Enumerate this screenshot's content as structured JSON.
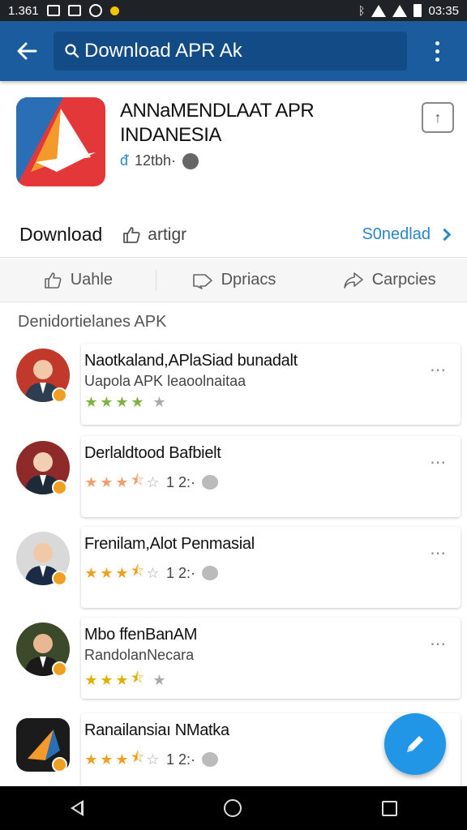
{
  "status_bar": {
    "time_left": "1.361",
    "time_right": "03:35",
    "icons": [
      "image-icon",
      "gallery-icon",
      "whatsapp-icon",
      "notification-dot-icon",
      "bluetooth-icon",
      "wifi-icon",
      "signal-icon",
      "battery-icon"
    ]
  },
  "app_bar": {
    "search_text": "Download APR Ak",
    "icons": [
      "back-arrow-icon",
      "search-icon",
      "more-vert-icon"
    ],
    "color": "#1a5c9e"
  },
  "app": {
    "title": "ANNaMENDLAAT APR INDANESIA",
    "meta": "12tbh·",
    "icon_colors": [
      "#e3373a",
      "#2a6fb5",
      "#f39a2a",
      "#ffffff"
    ]
  },
  "download_row": {
    "label": "Download",
    "action_label": "artigr",
    "link_label": "S0nedlad"
  },
  "tabs": [
    {
      "label": "Uahle",
      "icon": "thumbs-up-icon"
    },
    {
      "label": "Dpriacs",
      "icon": "tag-icon"
    },
    {
      "label": "Carpcies",
      "icon": "share-icon"
    }
  ],
  "section_title": "Denidortielanes APK",
  "list": [
    {
      "title": "Naotkaland,APlaSiad bunadalt",
      "subtitle": "Uapola APK leaoolnaitaa",
      "rating": 4,
      "star_color": "#7cb342",
      "rating_meta": ""
    },
    {
      "title": "Derlaldtood Bafbielt",
      "subtitle": "",
      "rating": 3.5,
      "star_color": "#f0a070",
      "rating_meta": "1 2:·"
    },
    {
      "title": "Frenilam,Alot Penmasial",
      "subtitle": "",
      "rating": 3.5,
      "star_color": "#f0a020",
      "rating_meta": "1 2:·"
    },
    {
      "title": "Mbo ffenBanAM",
      "subtitle": "RandolanNecara",
      "rating": 3.5,
      "star_color": "#e0b000",
      "rating_meta": ""
    },
    {
      "title": "Ranailansiaı NMatka",
      "subtitle": "",
      "rating": 3.5,
      "star_color": "#f0a020",
      "rating_meta": "1 2:·"
    }
  ],
  "fab": {
    "icon": "edit-icon",
    "color": "#2196e6"
  },
  "nav_bar": {
    "icons": [
      "nav-back-icon",
      "nav-home-icon",
      "nav-recents-icon"
    ]
  }
}
